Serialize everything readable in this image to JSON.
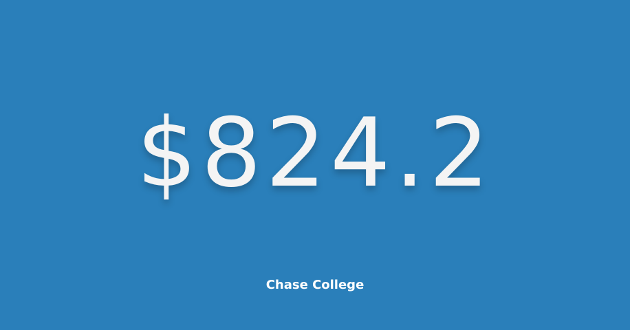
{
  "tile": {
    "value": "$824.2",
    "label": "Chase College",
    "background_color": "#2a7fba",
    "text_color": "#f4f4f4"
  }
}
